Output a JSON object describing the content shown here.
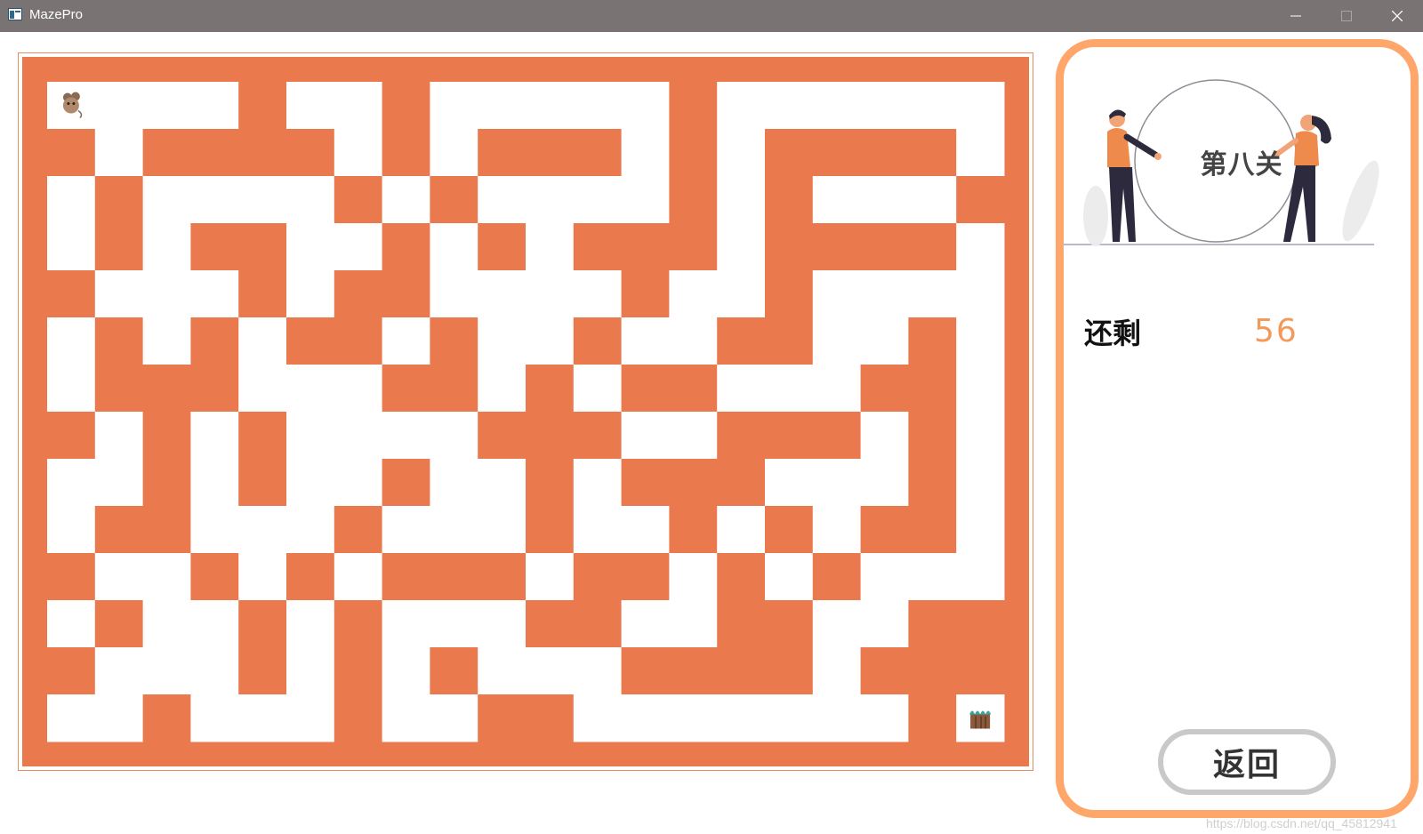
{
  "window": {
    "title": "MazePro",
    "controls": [
      "minimize-icon",
      "maximize-icon",
      "close-icon"
    ]
  },
  "colors": {
    "wall": "#ea7a4d",
    "panel_border": "#ffa76a",
    "remaining_value": "#f39a5a",
    "titlebar": "#797373"
  },
  "maze": {
    "cols": 20,
    "rows": 14,
    "rows_map": [
      "S...#..#.....#......",
      "#.####.#.###.#.####.",
      ".#....#.#....#.#...#",
      ".#.##..#.#.###.####.",
      "#...#.##....#..#....",
      ".#.#.##.#..#..##..#.",
      ".###...##.#.##...##.",
      "#.#.#....###..###.#.",
      "..#.#..#..#.###...#.",
      ".##...#...#..#.#.##.",
      "#..#.#.###.##.#.#...",
      ".#..#.#...##..##..##",
      "#...#.#.#...####.###",
      "..#...#..##.......#E"
    ],
    "player_icon": "mouse-icon",
    "goal_icon": "cake-icon"
  },
  "panel": {
    "level_title": "第八关",
    "remaining_label": "还剩",
    "remaining_value": "56",
    "back_button_label": "返回",
    "illustration_icon": "two-people-holding-circle-icon"
  },
  "watermark": "https://blog.csdn.net/qq_45812941"
}
